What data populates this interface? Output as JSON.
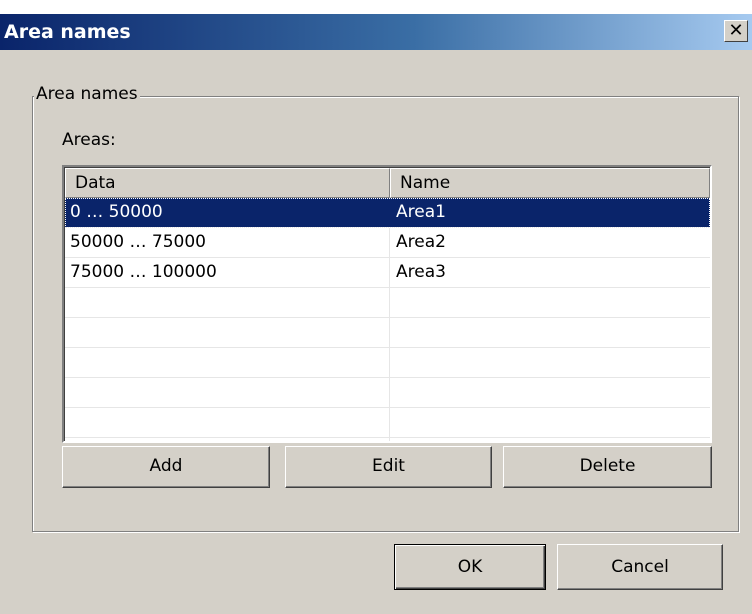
{
  "window": {
    "title": "Area names",
    "close_symbol": "✕"
  },
  "group": {
    "legend": "Area names",
    "areas_label": "Areas:"
  },
  "table": {
    "columns": [
      "Data",
      "Name"
    ],
    "rows": [
      {
        "data": "0 … 50000",
        "name": "Area1",
        "selected": true
      },
      {
        "data": "50000 … 75000",
        "name": "Area2",
        "selected": false
      },
      {
        "data": "75000 … 100000",
        "name": "Area3",
        "selected": false
      },
      {
        "data": "",
        "name": "",
        "selected": false
      },
      {
        "data": "",
        "name": "",
        "selected": false
      },
      {
        "data": "",
        "name": "",
        "selected": false
      },
      {
        "data": "",
        "name": "",
        "selected": false
      },
      {
        "data": "",
        "name": "",
        "selected": false
      }
    ]
  },
  "buttons": {
    "add": "Add",
    "edit": "Edit",
    "delete": "Delete",
    "ok": "OK",
    "cancel": "Cancel"
  },
  "colors": {
    "selection": "#0a246a",
    "face": "#d4d0c8"
  }
}
